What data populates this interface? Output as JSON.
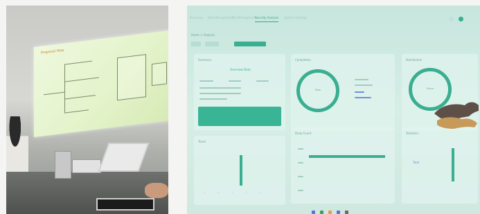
{
  "left_photo": {
    "projector_title": "Proposal Map",
    "projector_corner": "",
    "description_hidden": ""
  },
  "right_photo": {
    "nav_tabs": [
      {
        "label": "Overview"
      },
      {
        "label": "Data Management"
      },
      {
        "label": "Task Management"
      },
      {
        "label": "Security Analysis"
      },
      {
        "label": "System Settings"
      }
    ],
    "active_tab_index": 3,
    "breadcrumb": "Home > Analysis",
    "panels": {
      "left_top": {
        "title": "Summary",
        "highlight": "Overview Data"
      },
      "center_top": {
        "title": "Completion",
        "ring_label": "Rate"
      },
      "right_top": {
        "title": "Distribution",
        "ring_label": "Share"
      },
      "left_bottom": {
        "title": "Trend"
      },
      "center_bottom": {
        "title": "Daily Count"
      },
      "right_bottom": {
        "title": "Statistics",
        "value_label": "Total"
      }
    },
    "accent_color": "#3aae91",
    "link_color": "#6f8fd8"
  }
}
